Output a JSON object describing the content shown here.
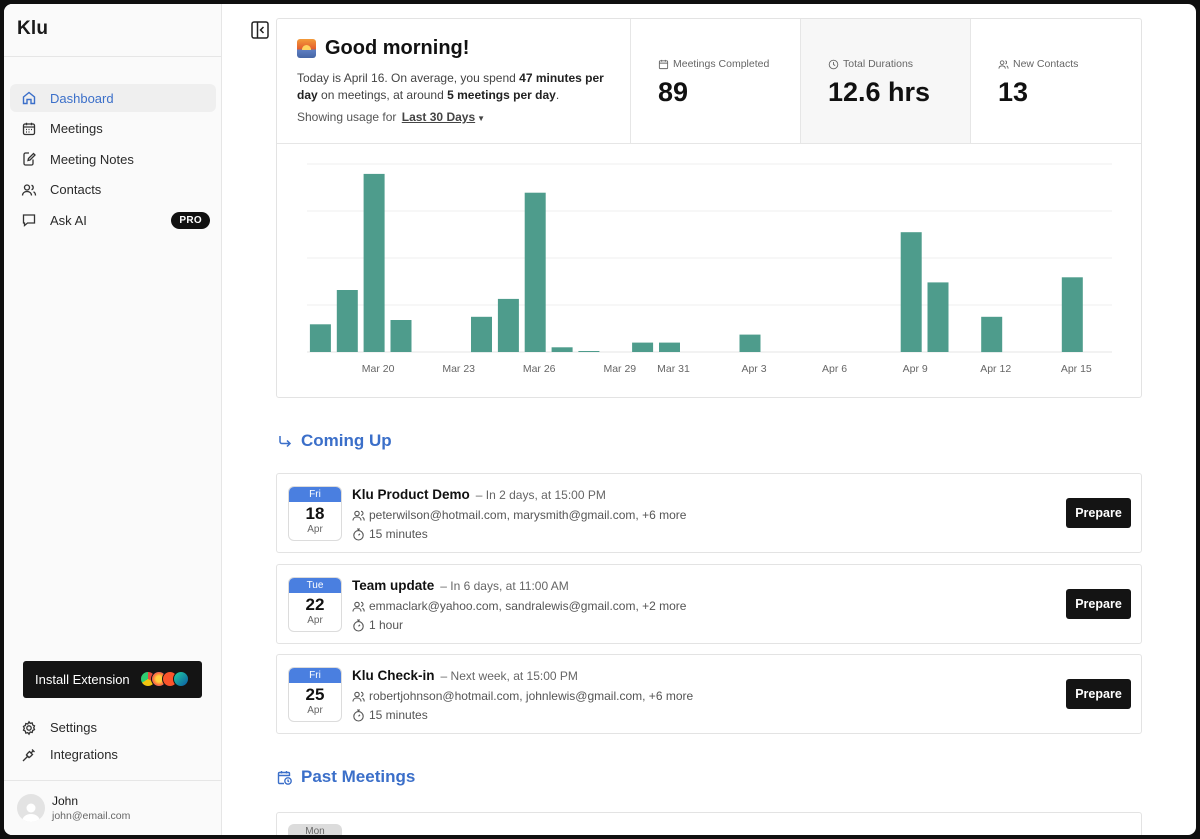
{
  "app": {
    "brand": "Klu"
  },
  "sidebar": {
    "items": [
      {
        "label": "Dashboard",
        "icon": "home-icon",
        "active": true
      },
      {
        "label": "Meetings",
        "icon": "calendar-icon"
      },
      {
        "label": "Meeting Notes",
        "icon": "edit-note-icon"
      },
      {
        "label": "Contacts",
        "icon": "users-icon"
      },
      {
        "label": "Ask AI",
        "icon": "chat-icon",
        "badge": "PRO"
      }
    ],
    "install": {
      "label": "Install Extension"
    },
    "bottom": [
      {
        "label": "Settings",
        "icon": "gear-icon"
      },
      {
        "label": "Integrations",
        "icon": "plug-icon"
      }
    ],
    "user": {
      "name": "John",
      "email": "john@email.com"
    }
  },
  "greeting": {
    "title": "Good morning!",
    "line1_pre": "Today is April 16. On average, you spend ",
    "minutes": "47 minutes per day",
    "line1_mid": " on meetings, at around ",
    "meetings_per_day": "5 meetings per day",
    "line1_post": ".",
    "usage_label": "Showing usage for",
    "usage_range": "Last 30 Days"
  },
  "stats": [
    {
      "label": "Meetings Completed",
      "value": "89",
      "icon": "calendar-icon"
    },
    {
      "label": "Total Durations",
      "value": "12.6 hrs",
      "icon": "clock-icon"
    },
    {
      "label": "New Contacts",
      "value": "13",
      "icon": "users-icon"
    }
  ],
  "chart_data": {
    "type": "bar",
    "color": "#4e9c8c",
    "x_tick_labels": [
      "Mar 20",
      "Mar 23",
      "Mar 26",
      "Mar 29",
      "Mar 31",
      "Apr 3",
      "Apr 6",
      "Apr 9",
      "Apr 12",
      "Apr 15"
    ],
    "categories": [
      "Mar 18",
      "Mar 19",
      "Mar 20",
      "Mar 21",
      "Mar 22",
      "Mar 23",
      "Mar 24",
      "Mar 25",
      "Mar 26",
      "Mar 27",
      "Mar 28",
      "Mar 29",
      "Mar 30",
      "Mar 31",
      "Apr 1",
      "Apr 2",
      "Apr 3",
      "Apr 4",
      "Apr 5",
      "Apr 6",
      "Apr 7",
      "Apr 8",
      "Apr 9",
      "Apr 10",
      "Apr 11",
      "Apr 12",
      "Apr 13",
      "Apr 14",
      "Apr 15",
      "Apr 16"
    ],
    "values": [
      0.59,
      1.32,
      3.79,
      0.68,
      0,
      0,
      0.75,
      1.13,
      3.39,
      0.1,
      0.01,
      0,
      0.2,
      0.2,
      0,
      0,
      0.37,
      0,
      0,
      0,
      0,
      0,
      2.55,
      1.48,
      0,
      0.75,
      0,
      0,
      1.59,
      0
    ],
    "ylim": [
      0,
      4
    ],
    "grid": true
  },
  "coming_up": {
    "title": "Coming Up",
    "meetings": [
      {
        "dow": "Fri",
        "day": "18",
        "mon": "Apr",
        "title": "Klu Product Demo",
        "when": "– In 2 days, at 15:00 PM",
        "attendees": "peterwilson@hotmail.com, marysmith@gmail.com, +6 more",
        "duration": "15 minutes",
        "action": "Prepare"
      },
      {
        "dow": "Tue",
        "day": "22",
        "mon": "Apr",
        "title": "Team update",
        "when": "– In 6 days, at 11:00 AM",
        "attendees": "emmaclark@yahoo.com, sandralewis@gmail.com, +2 more",
        "duration": "1 hour",
        "action": "Prepare"
      },
      {
        "dow": "Fri",
        "day": "25",
        "mon": "Apr",
        "title": "Klu Check-in",
        "when": "– Next week, at 15:00 PM",
        "attendees": "robertjohnson@hotmail.com, johnlewis@gmail.com, +6 more",
        "duration": "15 minutes",
        "action": "Prepare"
      }
    ]
  },
  "past": {
    "title": "Past Meetings",
    "first_dow": "Mon"
  }
}
